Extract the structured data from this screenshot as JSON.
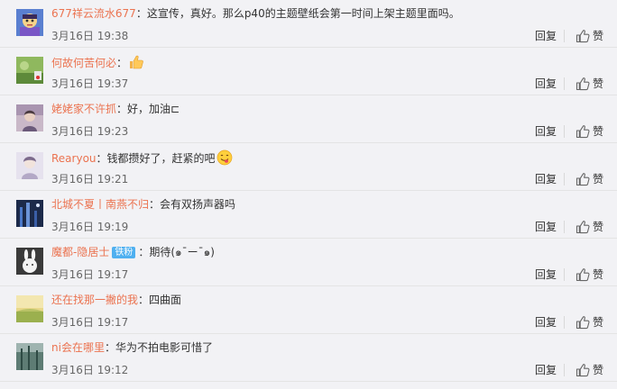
{
  "comments": [
    {
      "user": "677祥云流水677",
      "content": "：这宣传，真好。那么p40的主题壁纸会第一时间上架主题里面吗。",
      "time": "3月16日 19:38",
      "reply_label": "回复",
      "like_label": "赞",
      "avatar": "avatar-cartoon"
    },
    {
      "user": "何故何苦何必",
      "content": "：",
      "time": "3月16日 19:37",
      "reply_label": "回复",
      "like_label": "赞",
      "avatar": "avatar-green"
    },
    {
      "user": "姥姥家不许抓",
      "content": "：好，加油⊏",
      "time": "3月16日 19:23",
      "reply_label": "回复",
      "like_label": "赞",
      "avatar": "avatar-person"
    },
    {
      "user": "Rearyou",
      "content": "：钱都攒好了，赶紧的吧",
      "time": "3月16日 19:21",
      "reply_label": "回复",
      "like_label": "赞",
      "avatar": "avatar-light"
    },
    {
      "user": "北城不夏丨南燕不归",
      "content": "：会有双扬声器吗",
      "time": "3月16日 19:19",
      "reply_label": "回复",
      "like_label": "赞",
      "avatar": "avatar-night"
    },
    {
      "user": "魔都-隐居士",
      "badge": "铁粉",
      "content": "：期待(๑¯ー¯๑)",
      "time": "3月16日 19:17",
      "reply_label": "回复",
      "like_label": "赞",
      "avatar": "avatar-rabbit"
    },
    {
      "user": "还在找那一撇的我",
      "content": "：四曲面",
      "time": "3月16日 19:17",
      "reply_label": "回复",
      "like_label": "赞",
      "avatar": "avatar-field"
    },
    {
      "user": "ni会在哪里",
      "content": "：华为不拍电影可惜了",
      "time": "3月16日 19:12",
      "reply_label": "回复",
      "like_label": "赞",
      "avatar": "avatar-forest"
    }
  ],
  "emojis": {
    "thumbs": "thumbs-up-emoji",
    "smile": "tongue-smile-emoji"
  },
  "colors": {
    "username": "#eb7350",
    "badge": "#4fb0f0",
    "text": "#333333",
    "time": "#666666",
    "background": "#f2f2f5"
  }
}
